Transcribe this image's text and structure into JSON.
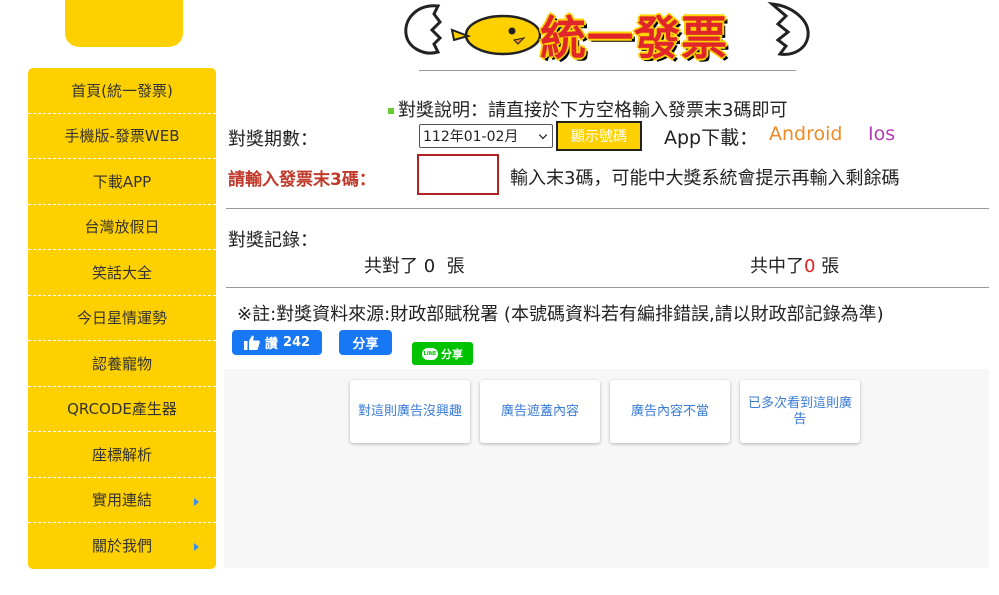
{
  "sidebar": {
    "items": [
      {
        "label": "首頁(統一發票)",
        "arrow": false
      },
      {
        "label": "手機版-發票WEB",
        "arrow": false
      },
      {
        "label": "下載APP",
        "arrow": false
      },
      {
        "label": "台灣放假日",
        "arrow": false
      },
      {
        "label": "笑話大全",
        "arrow": false
      },
      {
        "label": "今日星情運勢",
        "arrow": false
      },
      {
        "label": "認養寵物",
        "arrow": false
      },
      {
        "label": "QRCODE產生器",
        "arrow": false
      },
      {
        "label": "座標解析",
        "arrow": false
      },
      {
        "label": "實用連結",
        "arrow": true
      },
      {
        "label": "關於我們",
        "arrow": true
      }
    ]
  },
  "header": {
    "logo_text": "統一發票"
  },
  "main": {
    "instruction": "對獎說明：請直接於下方空格輸入發票末3碼即可",
    "period_label": "對獎期數：",
    "period_selected": "112年01-02月",
    "show_button": "顯示號碼",
    "app_label": "App下載：",
    "android_link": "Android",
    "ios_link": "Ios",
    "input_label": "請輸入發票末3碼：",
    "input_value": "",
    "input_hint": "輸入末3碼，可能中大獎系統會提示再輸入剩餘碼",
    "record_label": "對獎記錄：",
    "matched_prefix": "共對了",
    "matched_count": "0",
    "matched_unit": "張",
    "won_prefix": "共中了",
    "won_count": "0",
    "won_unit": "張",
    "note": "※註:對獎資料來源:財政部賦稅署 (本號碼資料若有編排錯誤,請以財政部記錄為準)"
  },
  "social": {
    "fb_like_label": "讚",
    "fb_like_count": "242",
    "fb_share_label": "分享",
    "line_badge": "LINE",
    "line_share_label": "分享"
  },
  "ads": {
    "feedback": [
      "對這則廣告沒興趣",
      "廣告遮蓋內容",
      "廣告內容不當",
      "已多次看到這則廣告"
    ]
  },
  "colors": {
    "brand_yellow": "#FFD000",
    "input_red": "#c0392b",
    "android_orange": "#f08a24",
    "ios_purple": "#b53ab5",
    "facebook_blue": "#1877f2",
    "line_green": "#00c300"
  }
}
